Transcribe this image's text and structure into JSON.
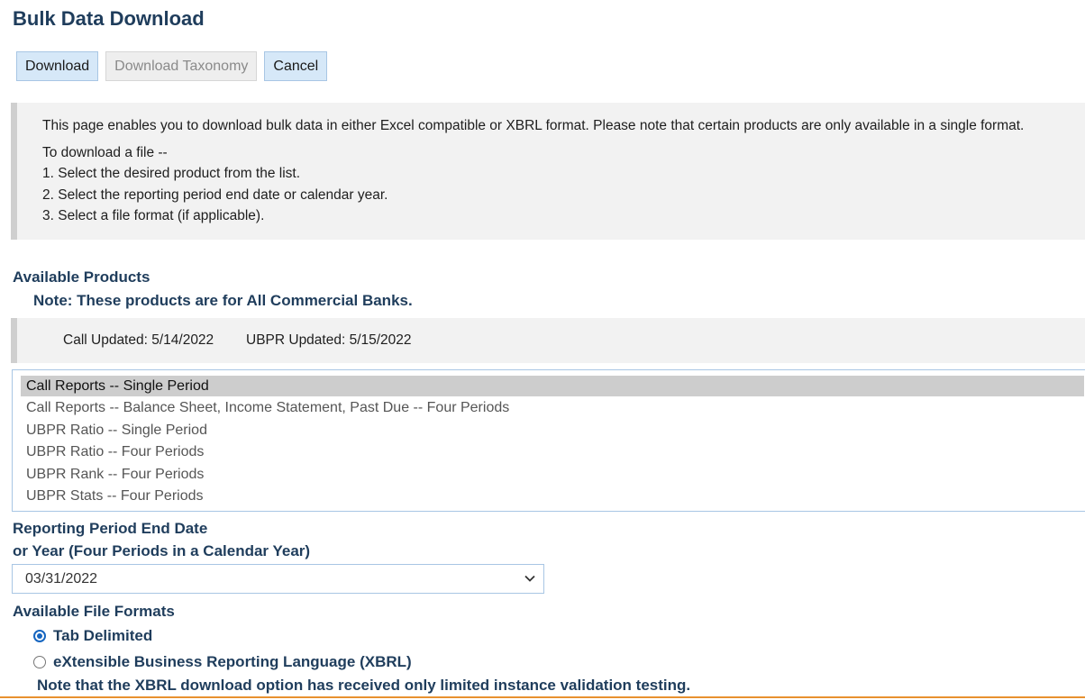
{
  "page_title": "Bulk Data Download",
  "buttons": {
    "download": "Download",
    "download_taxonomy": "Download Taxonomy",
    "cancel": "Cancel"
  },
  "intro": {
    "description": "This page enables you to download bulk data in either Excel compatible or XBRL format. Please note that certain products are only available in a single format.",
    "steps_heading": "To download a file --",
    "steps": [
      "1. Select the desired product from the list.",
      "2. Select the reporting period end date or calendar year.",
      "3. Select a file format (if applicable)."
    ]
  },
  "products": {
    "title": "Available Products",
    "note": "Note: These products are for All Commercial Banks.",
    "call_updated": "Call Updated: 5/14/2022",
    "ubpr_updated": "UBPR Updated: 5/15/2022",
    "options": [
      "Call Reports -- Single Period",
      "Call Reports -- Balance Sheet, Income Statement, Past Due -- Four Periods",
      "UBPR Ratio -- Single Period",
      "UBPR Ratio -- Four Periods",
      "UBPR Rank -- Four Periods",
      "UBPR Stats -- Four Periods"
    ],
    "selected_index": 0
  },
  "period": {
    "title_line1": "Reporting Period End Date",
    "title_line2": "or Year (Four Periods in a Calendar Year)",
    "selected": "03/31/2022"
  },
  "formats": {
    "title": "Available File Formats",
    "options": [
      "Tab Delimited",
      "eXtensible Business Reporting Language (XBRL)"
    ],
    "selected_index": 0,
    "note": "Note that the XBRL download option has received only limited instance validation testing."
  },
  "colors": {
    "heading": "#1f3d5c",
    "button_bg": "#d6e8f8",
    "accent_line": "#e8912f",
    "radio_checked": "#1565c0"
  }
}
